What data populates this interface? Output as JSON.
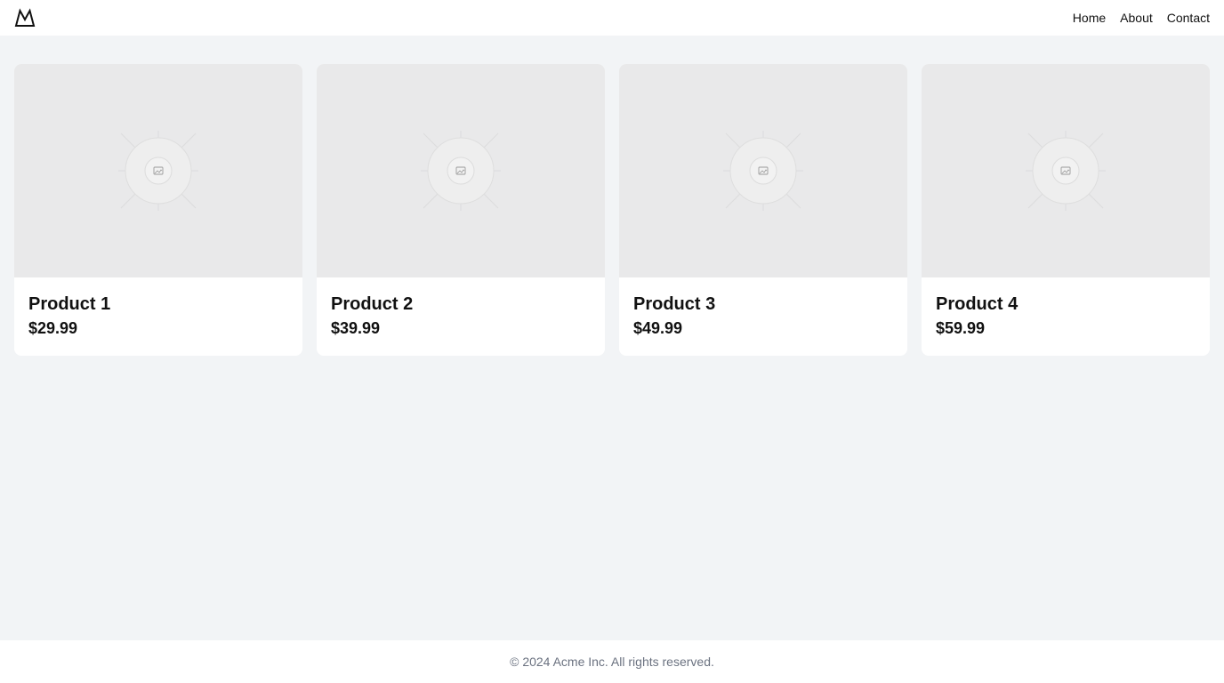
{
  "header": {
    "logo_icon": "mountain-logo-icon",
    "nav": [
      {
        "label": "Home"
      },
      {
        "label": "About"
      },
      {
        "label": "Contact"
      }
    ]
  },
  "products": [
    {
      "title": "Product 1",
      "price": "$29.99",
      "image_icon": "image-placeholder-icon"
    },
    {
      "title": "Product 2",
      "price": "$39.99",
      "image_icon": "image-placeholder-icon"
    },
    {
      "title": "Product 3",
      "price": "$49.99",
      "image_icon": "image-placeholder-icon"
    },
    {
      "title": "Product 4",
      "price": "$59.99",
      "image_icon": "image-placeholder-icon"
    }
  ],
  "footer": {
    "text": "© 2024 Acme Inc. All rights reserved."
  },
  "colors": {
    "background": "#f2f4f6",
    "surface": "#ffffff",
    "placeholder": "#e9e9ea",
    "text": "#111111",
    "muted": "#6b7280"
  }
}
